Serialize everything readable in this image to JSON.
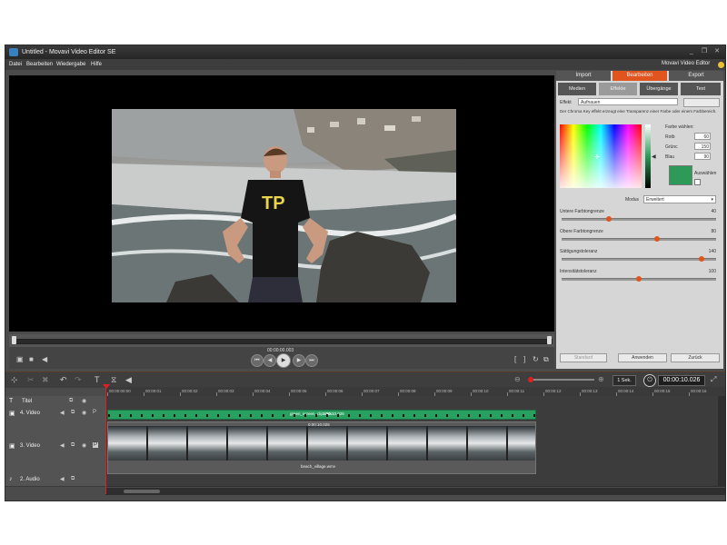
{
  "window": {
    "title": "Untitled - Movavi Video Editor SE",
    "controls": [
      "_",
      "❐",
      "✕"
    ]
  },
  "menu": [
    "Datei",
    "Bearbeiten",
    "Wiedergabe",
    "Hilfe"
  ],
  "brand": "Movavi Video Editor",
  "preview": {
    "timecode": "00:00:00.003",
    "progress": 0.0
  },
  "panel": {
    "top_tabs": [
      "Import",
      "Bearbeiten",
      "Export"
    ],
    "active_top_tab": "Bearbeiten",
    "sub_tabs": [
      "Medien",
      "Effekte",
      "Übergänge",
      "Text"
    ],
    "active_sub_tab": "Effekte",
    "effect_label": "Effekt",
    "effect_value": "Aufnauen",
    "description": "Der Chroma Key effekt erzeugt eine Transparenz einer Farbe oder einem Farbbereich.",
    "color_title": "Farbe wählen:",
    "rgb": [
      {
        "label": "Rotb",
        "value": "60"
      },
      {
        "label": "Grünc",
        "value": "150"
      },
      {
        "label": "Blau",
        "value": "90"
      }
    ],
    "picker_label": "Auswählen",
    "selected_color": "#2e9a57",
    "mode_label": "Modus",
    "mode_value": "Erweitert",
    "sliders": [
      {
        "label": "Untere Farbtongrenze",
        "value": "40",
        "fraction": 0.3
      },
      {
        "label": "Obere Farbtongrenze",
        "value": "80",
        "fraction": 0.62
      },
      {
        "label": "Sättigungstoleranz",
        "value": "140",
        "fraction": 0.92
      },
      {
        "label": "Intensitätstoleranz",
        "value": "100",
        "fraction": 0.5
      }
    ],
    "buttons": [
      "Standard",
      "Anwenden",
      "Zurück"
    ]
  },
  "timeline": {
    "zoom_label": "1 Sek.",
    "timecode": "00:00:10.026",
    "ruler_ticks": [
      "00:00:00:00",
      "00:00:01",
      "00:00:02",
      "00:00:03",
      "00:00:04",
      "00:00:05",
      "00:00:06",
      "00:00:07",
      "00:00:08",
      "00:00:09",
      "00:00:10",
      "00:00:11",
      "00:00:12",
      "00:00:13",
      "00:00:14",
      "00:00:15",
      "00:00:16"
    ],
    "tracks": [
      {
        "name": "Titel"
      },
      {
        "name": "4. Video",
        "clip_label": "green_screen_clip.mov",
        "clip_duration": "0:00:10.026"
      },
      {
        "name": "3. Video",
        "clip_label": "beach_village.wmv",
        "clip_duration": "0:00:10.026"
      },
      {
        "name": "2. Audio"
      }
    ]
  }
}
